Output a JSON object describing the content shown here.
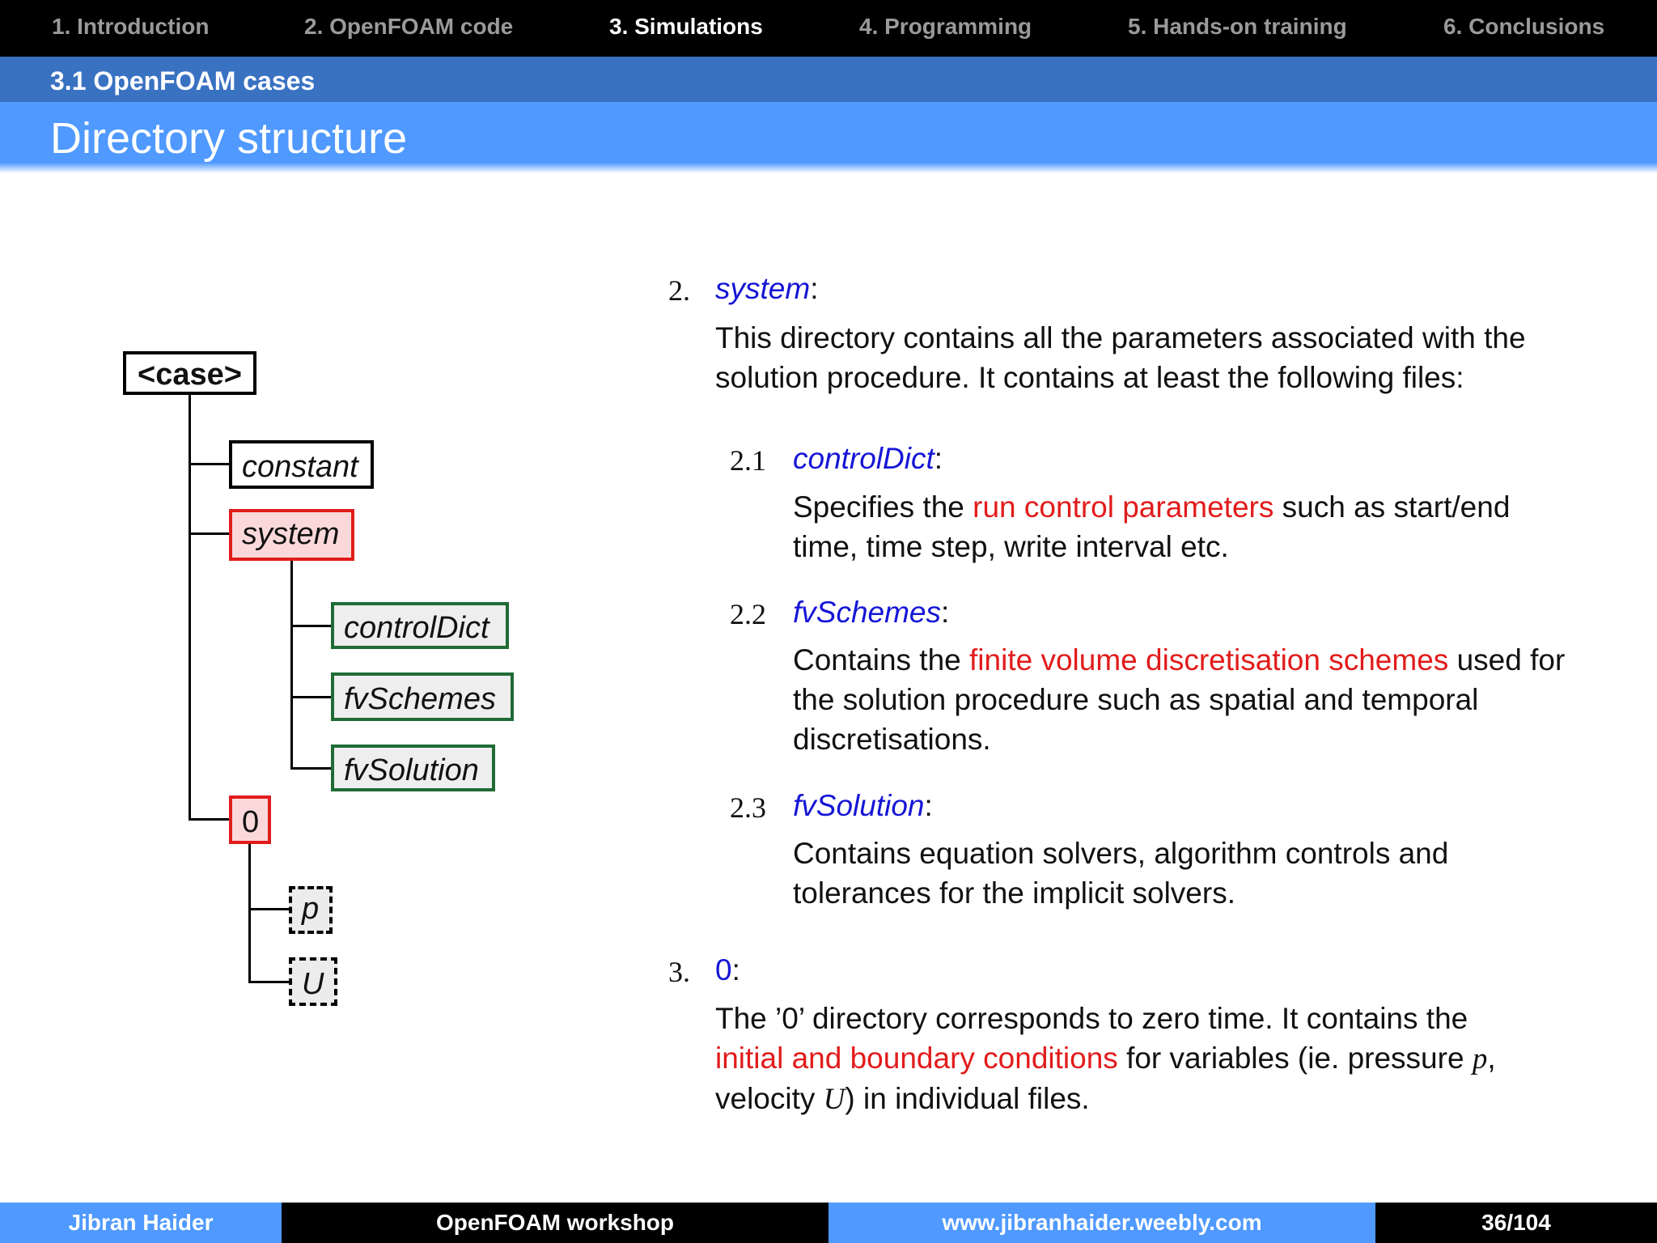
{
  "nav": {
    "items": [
      {
        "label": "1. Introduction"
      },
      {
        "label": "2. OpenFOAM code"
      },
      {
        "label": "3. Simulations"
      },
      {
        "label": "4. Programming"
      },
      {
        "label": "5. Hands-on training"
      },
      {
        "label": "6. Conclusions"
      }
    ],
    "active_index": 2
  },
  "subsection": "3.1 OpenFOAM cases",
  "title": "Directory structure",
  "tree": {
    "case": "<case>",
    "constant": "constant",
    "system": "system",
    "controlDict": "controlDict",
    "fvSchemes": "fvSchemes",
    "fvSolution": "fvSolution",
    "zero": "0",
    "p": "p",
    "U": "U"
  },
  "content": {
    "item2": {
      "number": "2.",
      "keyword": "system",
      "colon": ":",
      "text": "This directory contains all the parameters associated with the solution procedure. It contains at least the following files:"
    },
    "sub1": {
      "number": "2.1",
      "keyword": "controlDict",
      "colon": ":",
      "pre": "Specifies the ",
      "highlight": "run control parameters",
      "post": " such as start/end time, time step, write interval etc."
    },
    "sub2": {
      "number": "2.2",
      "keyword": "fvSchemes",
      "colon": ":",
      "pre": "Contains the ",
      "highlight": "finite volume discretisation schemes",
      "post": " used for the solution procedure such as spatial and temporal discretisations."
    },
    "sub3": {
      "number": "2.3",
      "keyword": "fvSolution",
      "colon": ":",
      "text": "Contains equation solvers, algorithm controls and tolerances for the implicit solvers."
    },
    "item3": {
      "number": "3.",
      "keyword": "0",
      "colon": ":",
      "line1": "The ’0’ directory corresponds to zero time. It contains the",
      "highlight": "initial and boundary conditions",
      "mid": " for variables (ie. pressure ",
      "var_p": "p",
      "comma": ",",
      "pre_u": "velocity ",
      "var_u": "U",
      "post": ") in individual files."
    }
  },
  "footer": {
    "author": "Jibran Haider",
    "event": "OpenFOAM workshop",
    "url": "www.jibranhaider.weebly.com",
    "page": "36/104"
  },
  "colors": {
    "accent_blue": "#4f99ff",
    "dark_blue": "#3a72c2",
    "keyword_blue": "#1515d6",
    "highlight_red": "#e21b1b",
    "box_green": "#1f6b35"
  }
}
